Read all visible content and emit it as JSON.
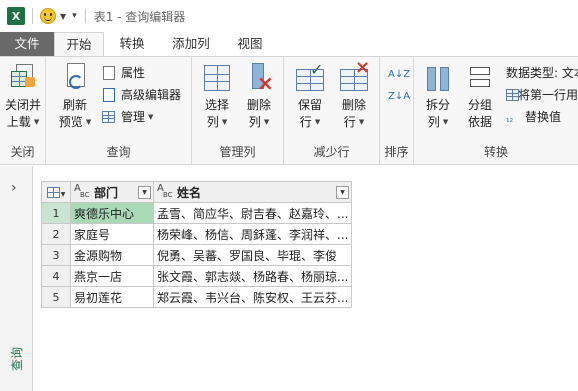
{
  "window": {
    "title_doc": "表1",
    "title_sep": " - ",
    "title_app": "查询编辑器"
  },
  "tabs": [
    {
      "label": "文件"
    },
    {
      "label": "开始"
    },
    {
      "label": "转换"
    },
    {
      "label": "添加列"
    },
    {
      "label": "视图"
    }
  ],
  "ribbon": {
    "close_group": {
      "btn_line1": "关闭并",
      "btn_line2": "上载",
      "label": "关闭"
    },
    "query_group": {
      "refresh_line1": "刷新",
      "refresh_line2": "预览",
      "properties": "属性",
      "advanced_editor": "高级编辑器",
      "manage": "管理",
      "label": "查询"
    },
    "manage_cols_group": {
      "choose_line1": "选择",
      "choose_line2": "列",
      "remove_line1": "删除",
      "remove_line2": "列",
      "label": "管理列"
    },
    "reduce_rows_group": {
      "keep_line1": "保留",
      "keep_line2": "行",
      "remove_line1": "删除",
      "remove_line2": "行",
      "label": "减少行"
    },
    "sort_group": {
      "label": "排序"
    },
    "transform_group": {
      "split_line1": "拆分",
      "split_line2": "列",
      "group_line1": "分组",
      "group_line2": "依据",
      "data_type": "数据类型: 文本",
      "first_row_header": "将第一行用",
      "replace_values": "替换值",
      "label": "转换"
    }
  },
  "nav_pane": {
    "label": "查询"
  },
  "table": {
    "columns": [
      {
        "type": "ABC",
        "name": "部门"
      },
      {
        "type": "ABC",
        "name": "姓名"
      }
    ],
    "rows": [
      {
        "n": "1",
        "dept": "爽德乐中心",
        "names": "孟雪、简应华、尉吉春、赵嘉玲、..."
      },
      {
        "n": "2",
        "dept": "家庭号",
        "names": "杨荣峰、杨信、周鉌蓬、李润祥、..."
      },
      {
        "n": "3",
        "dept": "金源购物",
        "names": "倪勇、吴蕃、罗国良、毕琨、李俊"
      },
      {
        "n": "4",
        "dept": "燕京一店",
        "names": "张文霞、郭志燚、杨路春、杨丽琼..."
      },
      {
        "n": "5",
        "dept": "易初莲花",
        "names": "郑云霞、韦兴台、陈安权、王云芬..."
      }
    ]
  },
  "colors": {
    "accent": "#217346",
    "selected_cell": "#a9d9b7",
    "file_tab": "#696969"
  }
}
